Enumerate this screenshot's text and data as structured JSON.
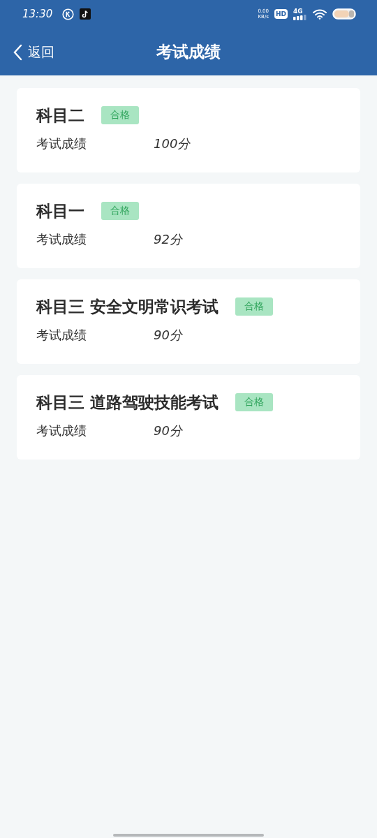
{
  "status_bar": {
    "time": "13:30",
    "net_speed": "0.00",
    "net_unit": "KB/s",
    "hd": "HD",
    "network": "4G"
  },
  "nav": {
    "back": "返回",
    "title": "考试成绩"
  },
  "results": [
    {
      "subject": "科目二",
      "badge": "合格",
      "label": "考试成绩",
      "score": "100分"
    },
    {
      "subject": "科目一",
      "badge": "合格",
      "label": "考试成绩",
      "score": "92分"
    },
    {
      "subject": "科目三 安全文明常识考试",
      "badge": "合格",
      "label": "考试成绩",
      "score": "90分"
    },
    {
      "subject": "科目三 道路驾驶技能考试",
      "badge": "合格",
      "label": "考试成绩",
      "score": "90分"
    }
  ]
}
